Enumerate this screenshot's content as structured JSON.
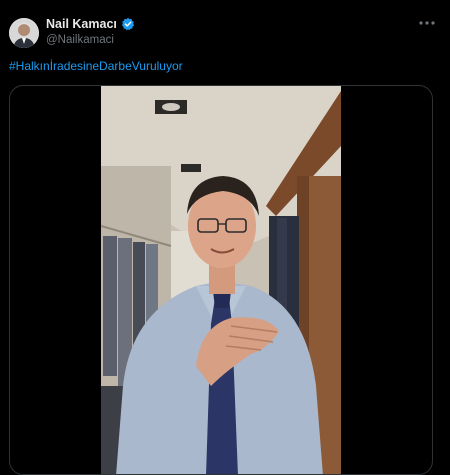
{
  "tweet": {
    "display_name": "Nail Kamacı",
    "handle": "@Nailkamaci",
    "hashtag": "#HalkınİradesineDarbeVuruluyor",
    "more_icon": "more-icon",
    "verified_icon": "verified-badge-icon",
    "media_type": "video"
  },
  "colors": {
    "background": "#000000",
    "primary_text": "#e7e9ea",
    "secondary_text": "#71767b",
    "link": "#1d9bf0",
    "verified": "#1d9bf0",
    "border": "#2f3336"
  }
}
